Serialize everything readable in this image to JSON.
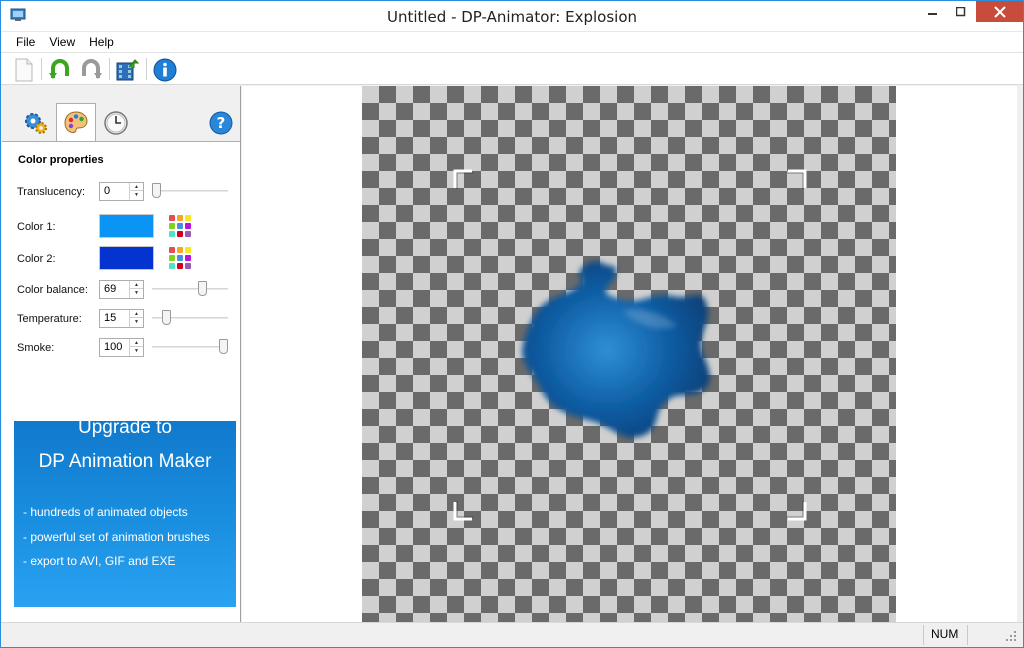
{
  "window": {
    "title": "Untitled - DP-Animator: Explosion"
  },
  "menu": {
    "items": [
      "File",
      "View",
      "Help"
    ]
  },
  "toolbar": {
    "buttons": [
      "new-icon",
      "undo-icon",
      "redo-icon",
      "export-icon",
      "info-icon"
    ]
  },
  "left_panel": {
    "tabs": [
      "settings-tab",
      "color-tab",
      "timing-tab"
    ],
    "active_tab": "color-tab",
    "section_title": "Color properties",
    "translucency": {
      "label": "Translucency:",
      "value": "0",
      "level": 0
    },
    "color1": {
      "label": "Color 1:",
      "color": "#0a95f4"
    },
    "color2": {
      "label": "Color 2:",
      "color": "#0433cf"
    },
    "color_balance": {
      "label": "Color balance:",
      "value": "69",
      "level": 69
    },
    "temperature": {
      "label": "Temperature:",
      "value": "15",
      "level": 15
    },
    "smoke": {
      "label": "Smoke:",
      "value": "100",
      "level": 100
    }
  },
  "promo": {
    "line1": "Upgrade to",
    "line2": "DP Animation Maker",
    "features": [
      "- hundreds of animated objects",
      "- powerful set of animation brushes",
      "- export to AVI, GIF and EXE"
    ]
  },
  "statusbar": {
    "num": "NUM"
  },
  "colors": {
    "accent": "#1a8fe0",
    "close": "#c74c3c",
    "smoke": "#0c5aa0"
  }
}
